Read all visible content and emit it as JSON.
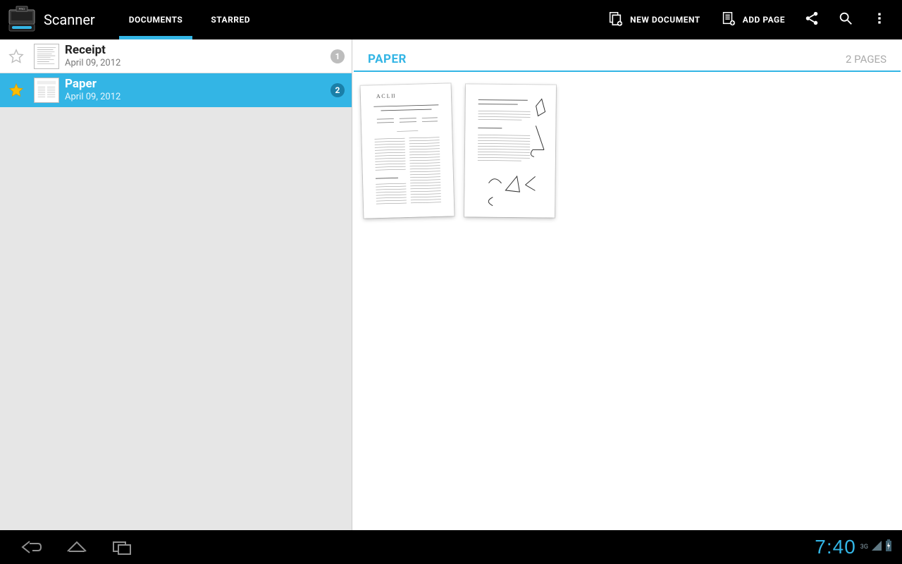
{
  "app": {
    "title": "Scanner"
  },
  "tabs": {
    "documents": "DOCUMENTS",
    "starred": "STARRED",
    "active": "documents"
  },
  "actions": {
    "new_document": "NEW DOCUMENT",
    "add_page": "ADD PAGE"
  },
  "documents": [
    {
      "title": "Receipt",
      "date": "April 09, 2012",
      "pages": "1",
      "starred": false
    },
    {
      "title": "Paper",
      "date": "April 09, 2012",
      "pages": "2",
      "starred": true
    }
  ],
  "selected_index": 1,
  "detail": {
    "title": "PAPER",
    "page_count_label": "2 PAGES"
  },
  "system": {
    "clock": "7:40",
    "network": "3G"
  },
  "colors": {
    "accent": "#33b5e5"
  }
}
